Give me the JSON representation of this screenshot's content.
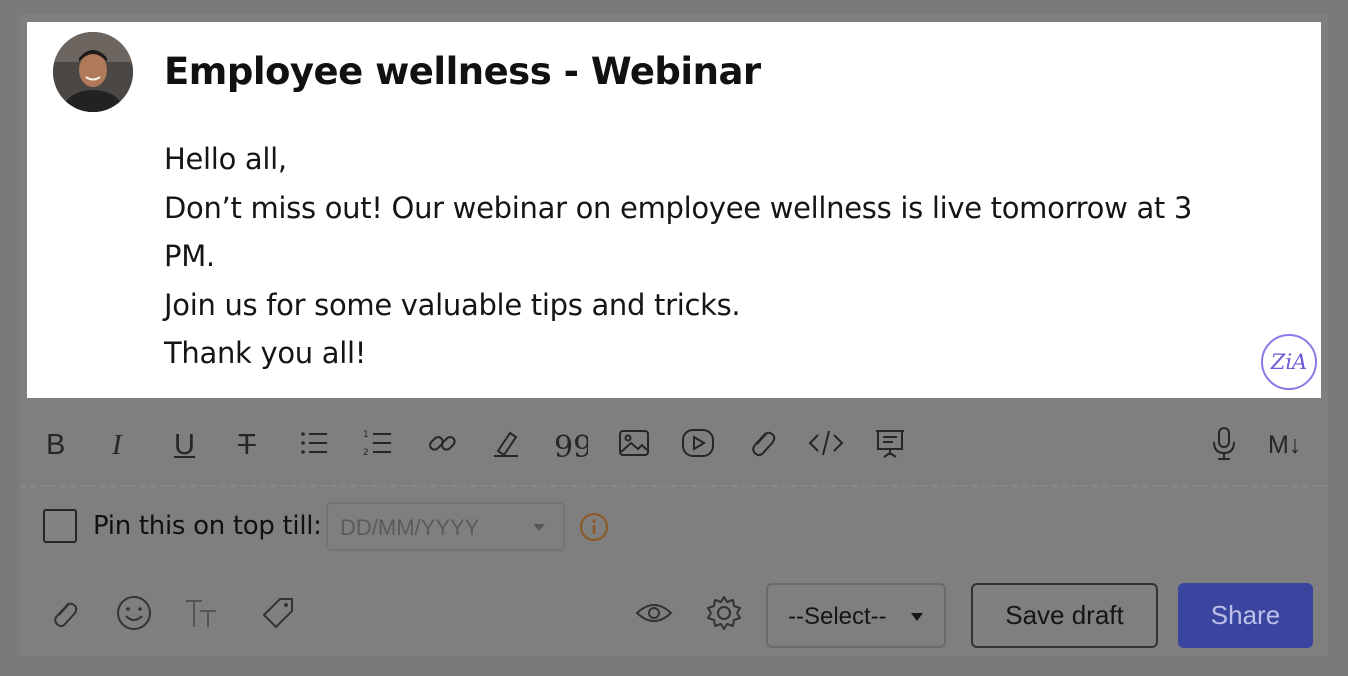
{
  "post": {
    "title": "Employee wellness - Webinar",
    "body_lines": [
      "Hello all,",
      "Don’t miss out! Our webinar on employee wellness is live tomorrow at 3 PM.",
      "Join us for some valuable tips and tricks.",
      "Thank you all!"
    ],
    "zia_label": "ZiA"
  },
  "toolbar": {
    "items": [
      "bold-icon",
      "italic-icon",
      "underline-icon",
      "strikethrough-icon",
      "bulleted-list-icon",
      "numbered-list-icon",
      "link-icon",
      "highlighter-icon",
      "quote-icon",
      "image-icon",
      "video-icon",
      "attachment-link-icon",
      "code-icon",
      "presentation-icon"
    ],
    "right_items": [
      "microphone-icon",
      "markdown-icon"
    ],
    "markdown_label": "M↓"
  },
  "pin": {
    "label": "Pin this on top till:",
    "checked": false,
    "date_placeholder": "DD/MM/YYYY"
  },
  "bottom": {
    "left_icons": [
      "attach-icon",
      "emoji-icon",
      "text-size-icon",
      "tag-icon"
    ],
    "select_value": "--Select--",
    "save_draft_label": "Save draft",
    "share_label": "Share"
  },
  "colors": {
    "share_bg": "#3a45a0",
    "zia_accent": "#8e77e6",
    "info_icon": "#8a5a2b"
  }
}
